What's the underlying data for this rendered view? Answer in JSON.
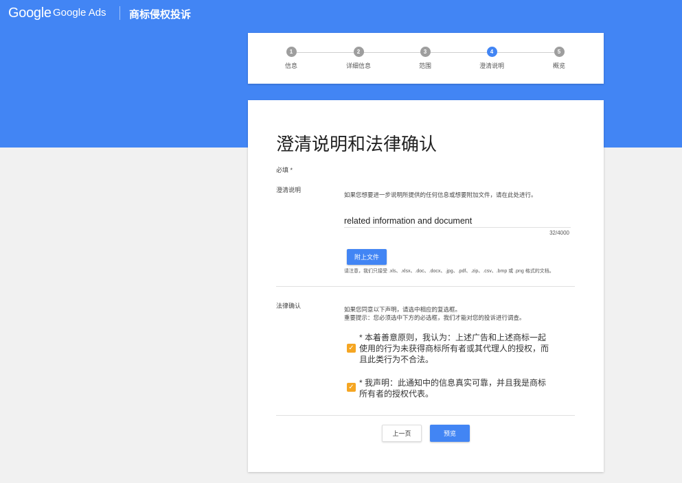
{
  "header": {
    "logo": "Google",
    "product": "Google Ads",
    "page_name": "商标侵权投诉"
  },
  "steps": [
    {
      "number": "1",
      "label": "信息"
    },
    {
      "number": "2",
      "label": "详细信息"
    },
    {
      "number": "3",
      "label": "范围"
    },
    {
      "number": "4",
      "label": "澄清说明"
    },
    {
      "number": "5",
      "label": "概览"
    }
  ],
  "active_step": 4,
  "form": {
    "title": "澄清说明和法律确认",
    "required_label": "必填 *",
    "clarification": {
      "label": "澄清说明",
      "description": "如果您想要进一步说明所提供的任何信息或想要附加文件，请在此处进行。",
      "value": "related information and document",
      "counter": "32/4000",
      "attach_label": "附上文件",
      "note": "请注意，我们只接受 .xls、.xlsx、.doc、.docx、.jpg、.pdf、.zip、.csv、.bmp 或 .png 格式的文档。"
    },
    "legal": {
      "label": "法律确认",
      "desc_line1": "如果您同意以下声明，请选中相应的复选框。",
      "desc_line2": "重要提示：您必须选中下方的必选框，我们才能对您的投诉进行调查。",
      "check1_line1": "* 本着善意原则，我认为：上述广告和上述商标一起",
      "check1_line2": "使用的行为未获得商标所有者或其代理人的授权，而",
      "check1_line3": "且此类行为不合法。",
      "check2_line1": "* 我声明：此通知中的信息真实可靠，并且我是商标",
      "check2_line2": "所有者的授权代表。",
      "check_mark": "✓"
    },
    "prev_label": "上一页",
    "preview_label": "预览"
  },
  "colors": {
    "brand_blue": "#4285f4",
    "checkbox_orange": "#f5a623",
    "step_inactive": "#9e9e9e"
  }
}
